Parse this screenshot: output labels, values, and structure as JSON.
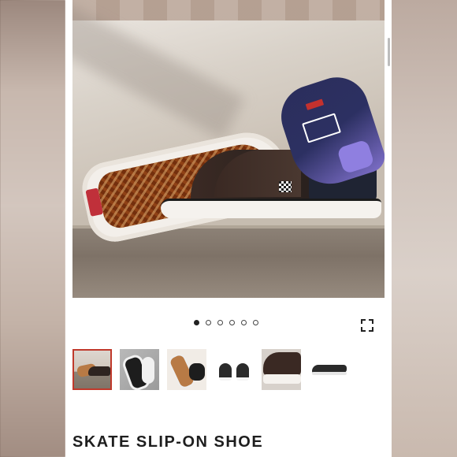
{
  "product": {
    "title": "SKATE SLIP-ON SHOE",
    "image_count": 6,
    "active_image_index": 0
  },
  "gallery": {
    "dots": [
      true,
      false,
      false,
      false,
      false,
      false
    ],
    "thumbnails": [
      {
        "label": "thumbnail-1",
        "active": true
      },
      {
        "label": "thumbnail-2",
        "active": false
      },
      {
        "label": "thumbnail-3",
        "active": false
      },
      {
        "label": "thumbnail-4",
        "active": false
      },
      {
        "label": "thumbnail-5",
        "active": false
      },
      {
        "label": "thumbnail-6",
        "active": false
      }
    ],
    "expand_icon": "expand-icon"
  },
  "colors": {
    "active_thumb_border": "#c0392b",
    "title_text": "#1e1e1e"
  }
}
